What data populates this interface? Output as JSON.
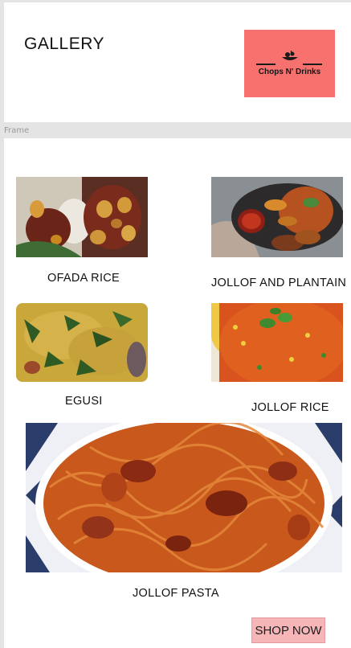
{
  "header": {
    "title": "GALLERY",
    "logo_text": "Chops N' Drinks",
    "logo_color": "#f7726e"
  },
  "frame_label": "Frame",
  "gallery": {
    "items": [
      {
        "caption": "OFADA RICE",
        "image": "ofada-rice-photo"
      },
      {
        "caption": "JOLLOF AND PLANTAIN",
        "image": "jollof-and-plantain-photo"
      },
      {
        "caption": "EGUSI",
        "image": "egusi-photo"
      },
      {
        "caption": "JOLLOF RICE",
        "image": "jollof-rice-photo"
      },
      {
        "caption": "JOLLOF PASTA",
        "image": "jollof-pasta-photo"
      }
    ]
  },
  "cta": {
    "label": "SHOP NOW",
    "color": "#f6b6b8"
  }
}
